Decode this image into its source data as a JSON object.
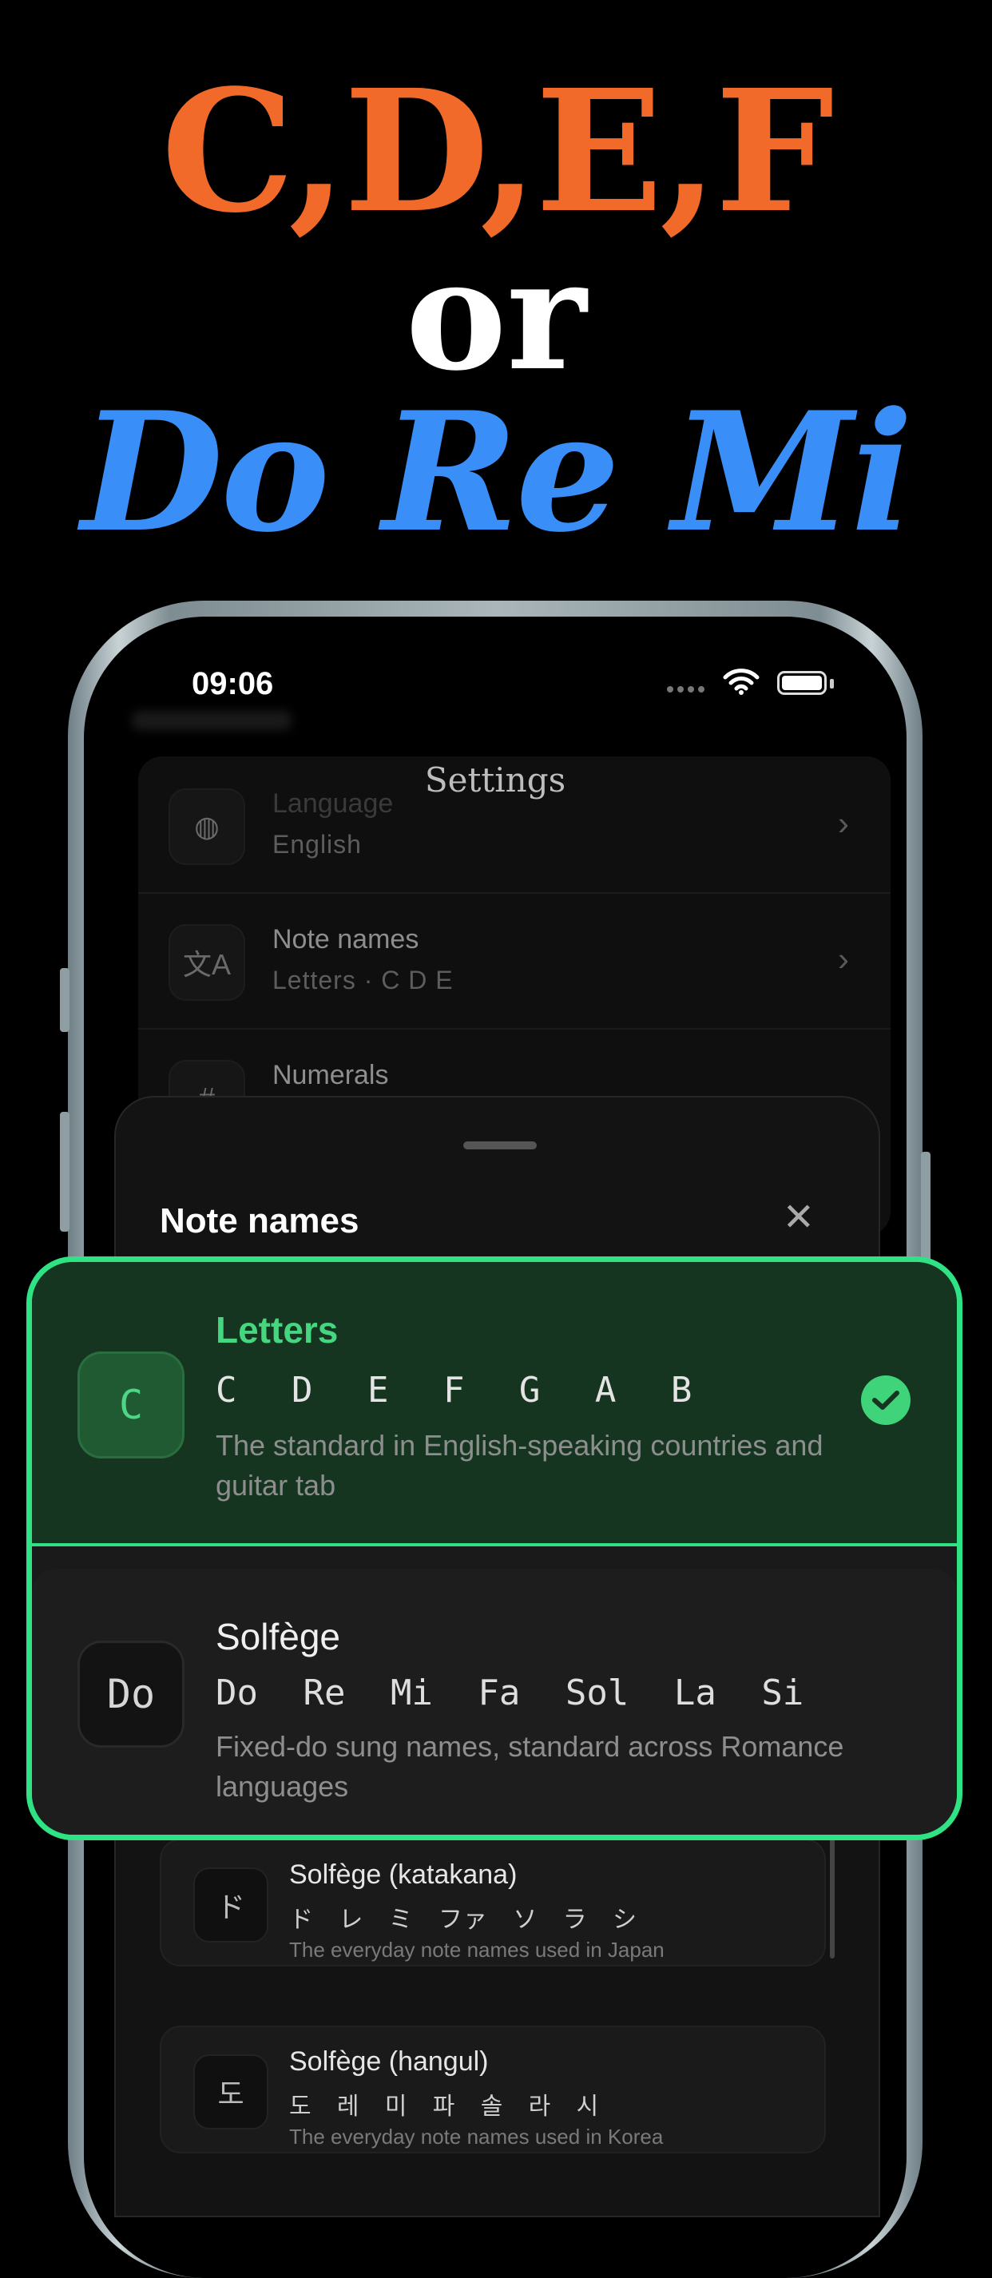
{
  "hero": {
    "line1": "C,D,E,F",
    "line2": "or",
    "line3": "Do Re Mi"
  },
  "status": {
    "time": "09:06"
  },
  "settings": {
    "title": "Settings",
    "rows": [
      {
        "title": "Language",
        "subtitle": "English",
        "icon": "globe-icon"
      },
      {
        "title": "Note names",
        "subtitle": "Letters · C D E",
        "icon": "translate-icon"
      },
      {
        "title": "Numerals",
        "subtitle": "",
        "icon": "numerals-icon"
      }
    ]
  },
  "sheet": {
    "title": "Note names",
    "options": [
      {
        "icon_text": "C",
        "title": "Letters",
        "notes": "C D E F G A B",
        "description": "The standard in English-speaking countries and guitar tab",
        "selected": true
      },
      {
        "icon_text": "Do",
        "title": "Solfège",
        "notes": "Do Re Mi Fa Sol La Si",
        "description": "Fixed-do sung names, standard across Romance languages",
        "selected": false
      },
      {
        "icon_text": "ド",
        "title": "Solfège (katakana)",
        "notes": "ド レ ミ ファ ソ ラ シ",
        "description": "The everyday note names used in Japan",
        "selected": false
      },
      {
        "icon_text": "도",
        "title": "Solfège (hangul)",
        "notes": "도 레 미 파 솔 라 시",
        "description": "The everyday note names used in Korea",
        "selected": false
      }
    ]
  },
  "colors": {
    "accent_green": "#2fe284",
    "hero_orange": "#f26a2a",
    "hero_blue": "#3a8ef7"
  }
}
